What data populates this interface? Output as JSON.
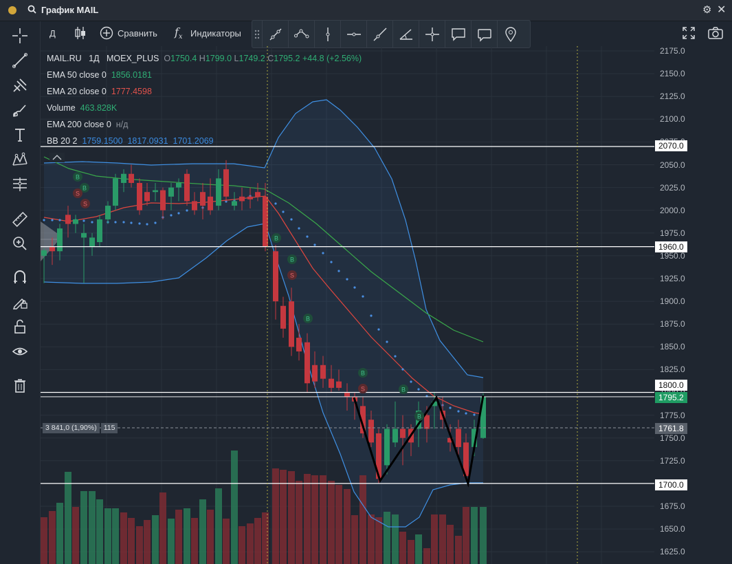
{
  "window": {
    "title": "График MAIL"
  },
  "toolbar": {
    "interval": "Д",
    "compare": "Сравнить",
    "indicators": "Индикаторы"
  },
  "legend": {
    "symbol": "MAIL.RU",
    "interval": "1Д",
    "exchange": "MOEX_PLUS",
    "o_label": "O",
    "o": "1750.4",
    "h_label": "H",
    "h": "1799.0",
    "l_label": "L",
    "l": "1749.2",
    "c_label": "C",
    "c": "1795.2",
    "change": "+44.8 (+2.56%)",
    "ema50": {
      "label": "EMA 50 close 0",
      "value": "1856.0181"
    },
    "ema20": {
      "label": "EMA 20 close 0",
      "value": "1777.4598"
    },
    "volume": {
      "label": "Volume",
      "value": "463.828K"
    },
    "ema200": {
      "label": "EMA 200 close 0",
      "value": "н/д"
    },
    "bb": {
      "label": "BB 20 2",
      "v1": "1759.1500",
      "v2": "1817.0931",
      "v3": "1701.2069"
    }
  },
  "crosshair": {
    "label1": "3 841,0 (1,90%)",
    "label2": "115",
    "price": "1761.8"
  },
  "price_axis": {
    "ticks": [
      "2175.0",
      "2150.0",
      "2125.0",
      "2100.0",
      "2075.0",
      "2050.0",
      "2025.0",
      "2000.0",
      "1975.0",
      "1950.0",
      "1925.0",
      "1900.0",
      "1875.0",
      "1850.0",
      "1825.0",
      "1800.0",
      "1775.0",
      "1750.0",
      "1725.0",
      "1700.0",
      "1675.0",
      "1650.0",
      "1625.0"
    ],
    "horizontal_lines": [
      "2070.0",
      "1960.0",
      "1800.0",
      "1700.0"
    ],
    "current_price": "1795.2"
  },
  "colors": {
    "up": "#2a9b68",
    "down": "#c5383f",
    "ema50": "#3aa84a",
    "ema20": "#e0463e",
    "bb": "#3f90e4",
    "current": "#1f9c63"
  },
  "icons": [
    "crosshair-icon",
    "trend-line-icon",
    "pitchfork-icon",
    "brush-icon",
    "text-icon",
    "pattern-icon",
    "fib-icon",
    "ruler-icon",
    "zoom-in-icon",
    "magnet-icon",
    "lock-drawing-icon",
    "unlock-icon",
    "eye-icon",
    "trash-icon"
  ],
  "signals": {
    "buy": "B",
    "sell": "S"
  }
}
